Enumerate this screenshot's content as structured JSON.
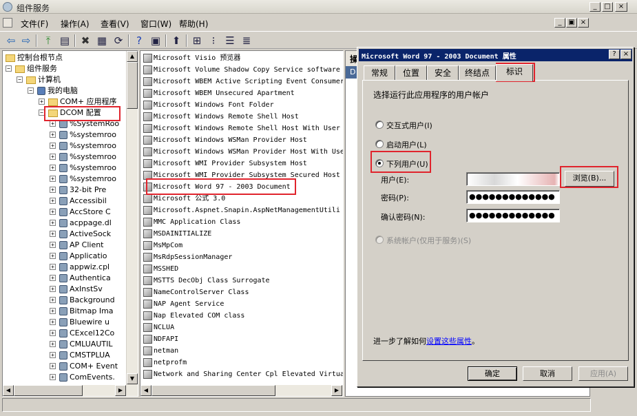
{
  "window": {
    "title": "组件服务",
    "min": "_",
    "max": "□",
    "close": "×",
    "inner_min": "_",
    "inner_restore": "▣",
    "inner_close": "×"
  },
  "menu": [
    "文件(F)",
    "操作(A)",
    "查看(V)",
    "窗口(W)",
    "帮助(H)"
  ],
  "toolbar": {
    "icons": [
      "back-icon",
      "forward-icon",
      "up-icon",
      "show-tree-icon",
      "delete-icon",
      "properties-icon",
      "refresh-icon",
      "help-icon",
      "mmc-icon",
      "new-icon",
      "large-icons-icon",
      "small-icons-icon",
      "list-icon",
      "detail-icon"
    ]
  },
  "tree": [
    {
      "label": "控制台根节点",
      "level": 0,
      "expander": "",
      "icon": "folder"
    },
    {
      "label": "组件服务",
      "level": 1,
      "expander": "−",
      "icon": "folder"
    },
    {
      "label": "计算机",
      "level": 2,
      "expander": "−",
      "icon": "folder"
    },
    {
      "label": "我的电脑",
      "level": 3,
      "expander": "−",
      "icon": "computer"
    },
    {
      "label": "COM+ 应用程序",
      "level": 4,
      "expander": "+",
      "icon": "folder"
    },
    {
      "label": "DCOM 配置",
      "level": 4,
      "expander": "−",
      "icon": "folder"
    },
    {
      "label": "%SystemRoo",
      "level": 5,
      "expander": "+",
      "icon": "gear"
    },
    {
      "label": "%systemroo",
      "level": 5,
      "expander": "+",
      "icon": "gear"
    },
    {
      "label": "%systemroo",
      "level": 5,
      "expander": "+",
      "icon": "gear"
    },
    {
      "label": "%systemroo",
      "level": 5,
      "expander": "+",
      "icon": "gear"
    },
    {
      "label": "%systemroo",
      "level": 5,
      "expander": "+",
      "icon": "gear"
    },
    {
      "label": "%systemroo",
      "level": 5,
      "expander": "+",
      "icon": "gear"
    },
    {
      "label": "32-bit Pre",
      "level": 5,
      "expander": "+",
      "icon": "gear"
    },
    {
      "label": "Accessibil",
      "level": 5,
      "expander": "+",
      "icon": "gear"
    },
    {
      "label": "AccStore C",
      "level": 5,
      "expander": "+",
      "icon": "gear"
    },
    {
      "label": "acppage.dl",
      "level": 5,
      "expander": "+",
      "icon": "gear"
    },
    {
      "label": "ActiveSock",
      "level": 5,
      "expander": "+",
      "icon": "gear"
    },
    {
      "label": "AP Client",
      "level": 5,
      "expander": "+",
      "icon": "gear"
    },
    {
      "label": "Applicatio",
      "level": 5,
      "expander": "+",
      "icon": "gear"
    },
    {
      "label": "appwiz.cpl",
      "level": 5,
      "expander": "+",
      "icon": "gear"
    },
    {
      "label": "Authentica",
      "level": 5,
      "expander": "+",
      "icon": "gear"
    },
    {
      "label": "AxInstSv",
      "level": 5,
      "expander": "+",
      "icon": "gear"
    },
    {
      "label": "Background",
      "level": 5,
      "expander": "+",
      "icon": "gear"
    },
    {
      "label": "Bitmap Ima",
      "level": 5,
      "expander": "+",
      "icon": "gear"
    },
    {
      "label": "Bluewire u",
      "level": 5,
      "expander": "+",
      "icon": "gear"
    },
    {
      "label": "CExcel12Co",
      "level": 5,
      "expander": "+",
      "icon": "gear"
    },
    {
      "label": "CMLUAUTIL",
      "level": 5,
      "expander": "+",
      "icon": "gear"
    },
    {
      "label": "CMSTPLUA",
      "level": 5,
      "expander": "+",
      "icon": "gear"
    },
    {
      "label": "COM+ Event",
      "level": 5,
      "expander": "+",
      "icon": "gear"
    },
    {
      "label": "ComEvents.",
      "level": 5,
      "expander": "+",
      "icon": "gear"
    }
  ],
  "list": [
    "Microsoft Visio 预览器",
    "Microsoft Volume Shadow Copy Service software",
    "Microsoft WBEM Active Scripting Event Consumer",
    "Microsoft WBEM Unsecured Apartment",
    "Microsoft Windows Font Folder",
    "Microsoft Windows Remote Shell Host",
    "Microsoft Windows Remote Shell Host With User",
    "Microsoft Windows WSMan Provider Host",
    "Microsoft Windows WSMan Provider Host With Use",
    "Microsoft WMI Provider Subsystem Host",
    "Microsoft WMI Provider Subsystem Secured Host",
    "Microsoft Word 97 - 2003 Document",
    "Microsoft 公式 3.0",
    "Microsoft.Aspnet.Snapin.AspNetManagementUtili",
    "MMC Application Class",
    "MSDAINITIALIZE",
    "MsMpCom",
    "MsRdpSessionManager",
    "MSSHED",
    "MSTTS DecObj Class Surrogate",
    "NameControlServer Class",
    "NAP Agent Service",
    "Nap Elevated COM class",
    "NCLUA",
    "NDFAPI",
    "netman",
    "netprofm",
    "Network and Sharing Center Cpl Elevated Virtua"
  ],
  "hidden_pane_header": "操",
  "hidden_pane_sub": "D",
  "dialog": {
    "title": "Microsoft Word 97 - 2003 Document 属性",
    "help": "?",
    "close": "×",
    "tabs": [
      "常规",
      "位置",
      "安全",
      "终结点",
      "标识"
    ],
    "heading": "选择运行此应用程序的用户帐户",
    "options": [
      "交互式用户(I)",
      "启动用户(L)",
      "下列用户(U)",
      "系统帐户(仅用于服务)(S)"
    ],
    "selected_option": "下列用户(U)",
    "user_label": "用户(E):",
    "user_value": "",
    "password_label": "密码(P):",
    "password_value": "●●●●●●●●●●●●●",
    "confirm_label": "确认密码(N):",
    "confirm_value": "●●●●●●●●●●●●●",
    "browse_button": "浏览(B)...",
    "learn_prefix": "进一步了解如何",
    "learn_link": "设置这些属性",
    "learn_suffix": "。",
    "ok": "确定",
    "cancel": "取消",
    "apply": "应用(A)"
  },
  "colors": {
    "highlight_border": "#e0232c",
    "dialog_title_bg": "#0a246a",
    "link": "#0000ff"
  }
}
